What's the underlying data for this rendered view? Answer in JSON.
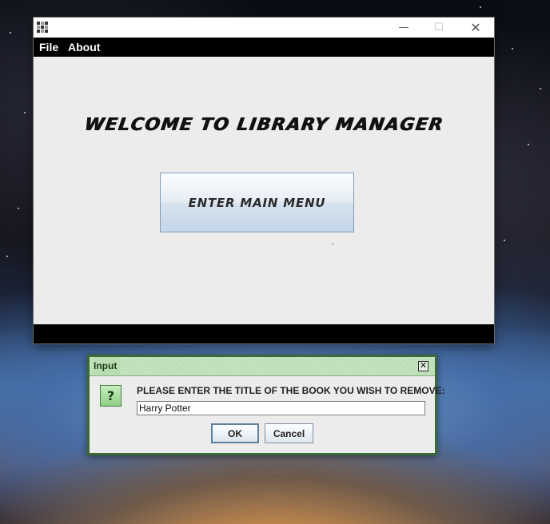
{
  "main_window": {
    "menu": [
      "File",
      "About"
    ],
    "welcome_title": "WELCOME TO LIBRARY MANAGER",
    "enter_button_label": "ENTER MAIN MENU",
    "window_controls": {
      "minimize": "—",
      "maximize": "☐",
      "close": "✕"
    }
  },
  "dialog": {
    "title": "Input",
    "close_glyph": "✕",
    "icon_glyph": "?",
    "prompt": "PLEASE ENTER THE TITLE OF THE BOOK YOU WISH TO REMOVE:",
    "input_value": "Harry Potter",
    "ok_label": "OK",
    "cancel_label": "Cancel"
  },
  "colors": {
    "dialog_border": "#3b6b35",
    "dialog_titlebar": "#b9dcb3",
    "menubar": "#000000"
  }
}
